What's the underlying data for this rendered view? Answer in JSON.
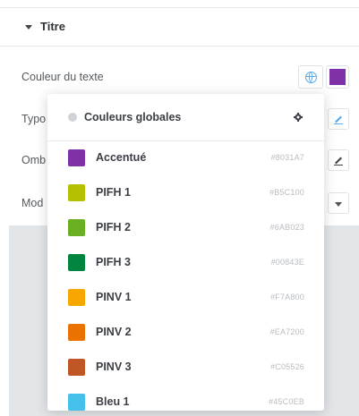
{
  "section": {
    "title": "Titre"
  },
  "controls": {
    "text_color_label": "Couleur du texte",
    "typography_label": "Typo",
    "shadow_label": "Omb",
    "mode_label": "Mod",
    "current_color": "#8031A7"
  },
  "popover": {
    "title": "Couleurs globales",
    "colors": [
      {
        "name": "Accentué",
        "hex": "#8031A7"
      },
      {
        "name": "PIFH 1",
        "hex": "#B5C100"
      },
      {
        "name": "PIFH 2",
        "hex": "#6AB023"
      },
      {
        "name": "PIFH 3",
        "hex": "#00843E"
      },
      {
        "name": "PINV 1",
        "hex": "#F7A800"
      },
      {
        "name": "PINV 2",
        "hex": "#EA7200"
      },
      {
        "name": "PINV 3",
        "hex": "#C05526"
      },
      {
        "name": "Bleu 1",
        "hex": "#45C0EB"
      }
    ]
  },
  "icons": {
    "section_toggle": "caret-down-icon",
    "global": "globe-icon",
    "edit": "pencil-icon",
    "info": "info-icon",
    "settings": "gear-icon",
    "dropdown": "chevron-down-icon"
  }
}
